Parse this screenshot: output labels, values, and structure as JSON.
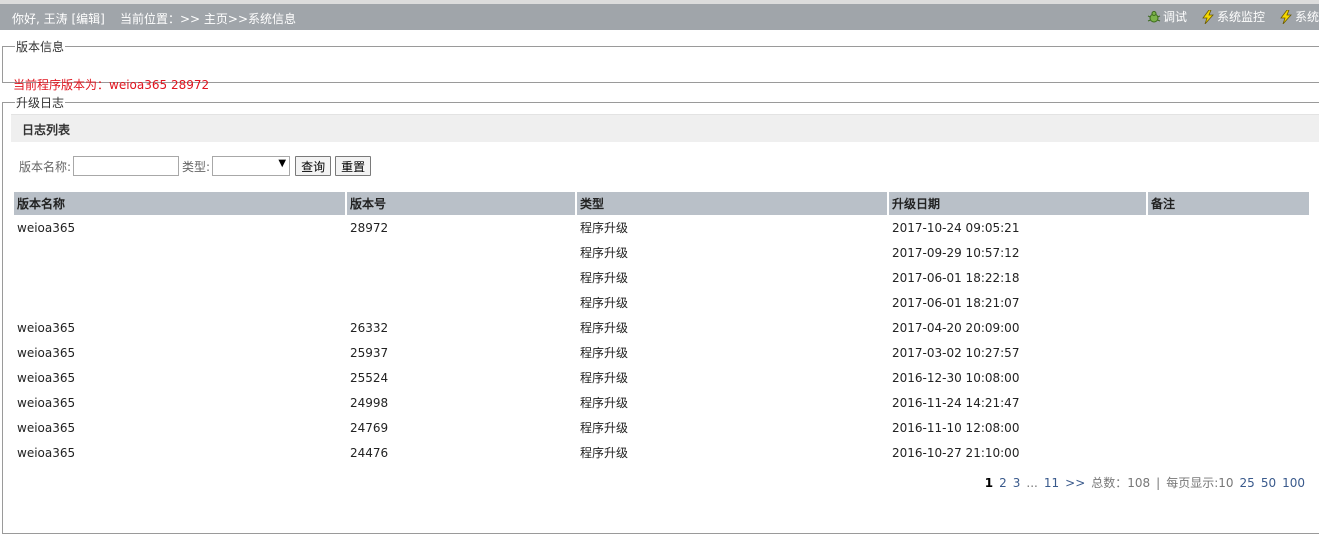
{
  "topbar": {
    "greeting": "你好, 王涛 [编辑]",
    "location": "当前位置：>> 主页>>系统信息",
    "actions": [
      {
        "label": "调试",
        "icon": "bug-icon"
      },
      {
        "label": "系统监控",
        "icon": "lightning-icon"
      },
      {
        "label": "系统",
        "icon": "lightning-icon"
      }
    ]
  },
  "version_section": {
    "legend": "版本信息",
    "text": "当前程序版本为：weioa365 28972"
  },
  "log_section": {
    "legend": "升级日志",
    "list_title": "日志列表",
    "search": {
      "name_label": "版本名称:",
      "name_value": "",
      "type_label": "类型:",
      "type_value": "",
      "query_button": "查询",
      "reset_button": "重置"
    },
    "columns": [
      "版本名称",
      "版本号",
      "类型",
      "升级日期",
      "备注"
    ],
    "rows": [
      [
        "weioa365",
        "28972",
        "程序升级",
        "2017-10-24 09:05:21",
        ""
      ],
      [
        "",
        "",
        "程序升级",
        "2017-09-29 10:57:12",
        ""
      ],
      [
        "",
        "",
        "程序升级",
        "2017-06-01 18:22:18",
        ""
      ],
      [
        "",
        "",
        "程序升级",
        "2017-06-01 18:21:07",
        ""
      ],
      [
        "weioa365",
        "26332",
        "程序升级",
        "2017-04-20 20:09:00",
        ""
      ],
      [
        "weioa365",
        "25937",
        "程序升级",
        "2017-03-02 10:27:57",
        ""
      ],
      [
        "weioa365",
        "25524",
        "程序升级",
        "2016-12-30 10:08:00",
        ""
      ],
      [
        "weioa365",
        "24998",
        "程序升级",
        "2016-11-24 14:21:47",
        ""
      ],
      [
        "weioa365",
        "24769",
        "程序升级",
        "2016-11-10 12:08:00",
        ""
      ],
      [
        "weioa365",
        "24476",
        "程序升级",
        "2016-10-27 21:10:00",
        ""
      ]
    ],
    "pager": {
      "current": "1",
      "pages": [
        "2",
        "3"
      ],
      "ellipsis": "...",
      "last": "11",
      "next": ">>",
      "total": "总数：108",
      "sep": "|",
      "per_page_label": "每页显示:10",
      "per_page_options": [
        "25",
        "50",
        "100"
      ]
    }
  },
  "colors": {
    "topbar_bg": "#a0a5aa",
    "header_bg": "#b9c0c8",
    "version_text": "#e0141e",
    "link": "#3a5a8c"
  }
}
